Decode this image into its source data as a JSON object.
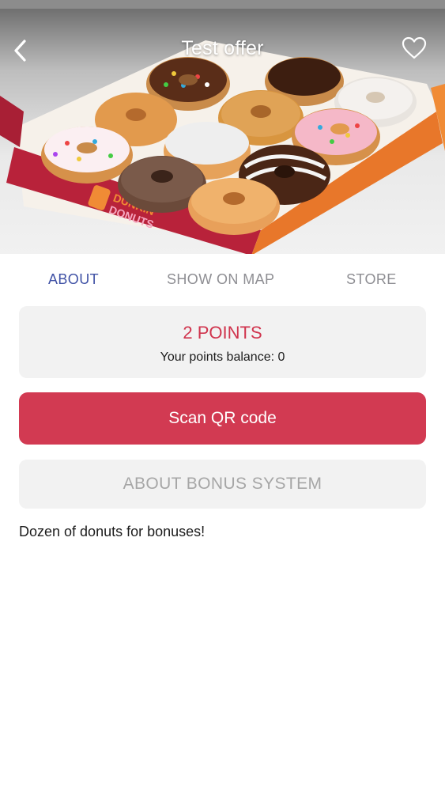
{
  "header": {
    "title": "Test offer",
    "back_icon": "chevron-left-icon",
    "favorite_icon": "heart-outline-icon"
  },
  "hero_image": {
    "subject": "Box of a dozen donuts",
    "logo_text_line1": "DUNKIN'",
    "logo_text_line2": "DONUTS"
  },
  "tabs": [
    {
      "label": "ABOUT",
      "active": true
    },
    {
      "label": "SHOW ON MAP",
      "active": false
    },
    {
      "label": "STORE",
      "active": false
    }
  ],
  "points": {
    "value": "2 POINTS",
    "balance_text": "Your points balance: 0"
  },
  "actions": {
    "scan_label": "Scan QR code",
    "about_bonus_label": "ABOUT BONUS SYSTEM"
  },
  "description": "Dozen of donuts for bonuses!",
  "colors": {
    "accent": "#d23a52",
    "active_tab": "#3f51a5",
    "inactive_tab": "#8e8e93",
    "card_bg": "#f2f2f2"
  }
}
